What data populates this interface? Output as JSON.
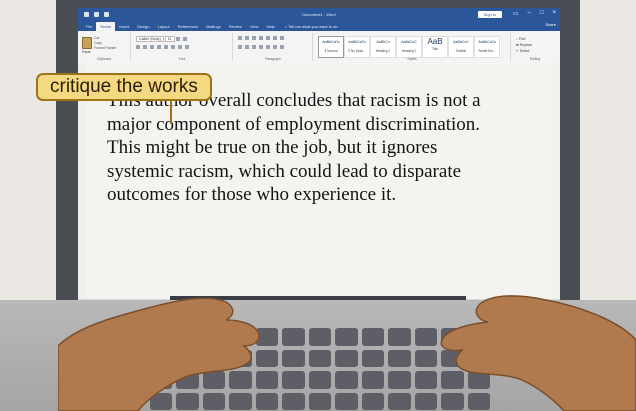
{
  "window": {
    "doc_title": "Document1 - Word",
    "signin_label": "Sign in",
    "share_label": "Share",
    "tell_me": "Tell me what you want to do"
  },
  "ribbon": {
    "tabs": [
      "File",
      "Home",
      "Insert",
      "Design",
      "Layout",
      "References",
      "Mailings",
      "Review",
      "View",
      "Help"
    ],
    "active_tab": "Home",
    "clipboard": {
      "paste": "Paste",
      "cut": "Cut",
      "copy": "Copy",
      "format_painter": "Format Painter",
      "label": "Clipboard"
    },
    "font": {
      "name": "Calibri (Body)",
      "size": "11",
      "label": "Font"
    },
    "paragraph": {
      "label": "Paragraph"
    },
    "styles": {
      "items": [
        {
          "sample": "AaBbCcDc",
          "name": "¶ Normal"
        },
        {
          "sample": "AaBbCcDc",
          "name": "¶ No Spac..."
        },
        {
          "sample": "AaBbCc",
          "name": "Heading 1"
        },
        {
          "sample": "AaBbCcC",
          "name": "Heading 2"
        },
        {
          "sample": "AaB",
          "name": "Title"
        },
        {
          "sample": "AaBbCcC",
          "name": "Subtitle"
        },
        {
          "sample": "AaBbCcDc",
          "name": "Subtle Em..."
        }
      ],
      "label": "Styles"
    },
    "editing": {
      "find": "Find",
      "replace": "Replace",
      "select": "Select",
      "label": "Editing"
    }
  },
  "document": {
    "lines": [
      "This author overall concludes that racism is not a",
      "major component of employment discrimination.",
      "This might be true on the job, but it ignores",
      "systemic racism, which could lead to disparate",
      "outcomes for those who experience it."
    ]
  },
  "callout": {
    "text": "critique the works"
  },
  "colors": {
    "word_blue": "#2b579a",
    "callout_fill": "#f5d982",
    "callout_border": "#9c7416",
    "laptop_bezel": "#4b4d55",
    "skin": "#b07a4e"
  }
}
